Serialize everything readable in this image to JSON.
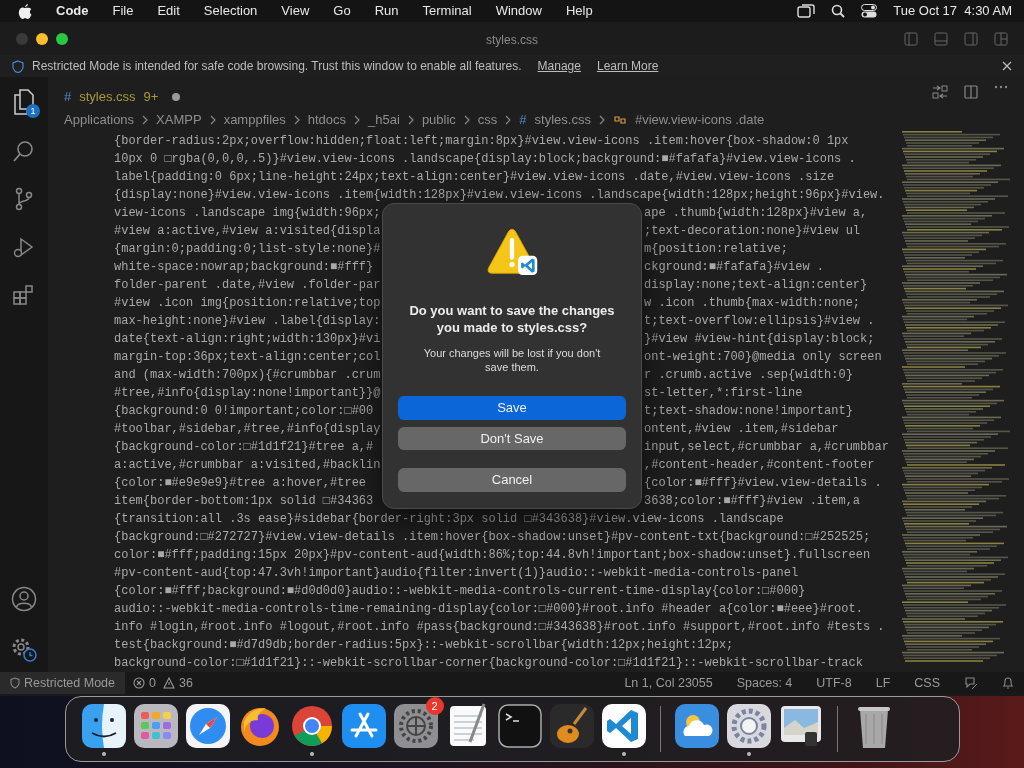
{
  "menubar": {
    "app": "Code",
    "items": [
      "File",
      "Edit",
      "Selection",
      "View",
      "Go",
      "Run",
      "Terminal",
      "Window",
      "Help"
    ],
    "clock": "Tue Oct 17  4:30 AM"
  },
  "window": {
    "title": "styles.css"
  },
  "banner": {
    "text": "Restricted Mode is intended for safe code browsing. Trust this window to enable all features.",
    "links": [
      "Manage",
      "Learn More"
    ]
  },
  "activity_bar": {
    "explorer_badge": "1"
  },
  "tab": {
    "glyph": "#",
    "label": "styles.css",
    "problems": "9+",
    "modified": true
  },
  "breadcrumb": [
    {
      "kind": "folder",
      "label": "Applications"
    },
    {
      "kind": "folder",
      "label": "XAMPP"
    },
    {
      "kind": "folder",
      "label": "xamppfiles"
    },
    {
      "kind": "folder",
      "label": "htdocs"
    },
    {
      "kind": "folder",
      "label": "_h5ai"
    },
    {
      "kind": "folder",
      "label": "public"
    },
    {
      "kind": "folder",
      "label": "css"
    },
    {
      "kind": "file",
      "glyph": "#",
      "label": "styles.css"
    },
    {
      "kind": "symbol",
      "label": "#view.view-icons .date"
    }
  ],
  "code_lines": [
    {
      "segments": [
        "{border-radius:2px;overflow:hidden;float:left;margin:8px}#view.view-icons .item:hover{box-shadow:0 1px"
      ]
    },
    {
      "segments": [
        "10px 0 □rgba(0,0,0,.5)}#view.view-icons .landscape{display:block;background:■#fafafa}#view.view-icons ."
      ]
    },
    {
      "segments": [
        "label{padding:0 6px;line-height:24px;text-align:center}#view.view-icons .date,#view.view-icons .size"
      ]
    },
    {
      "segments": [
        "{display:none}#view.view-icons .item{width:128px}#view.view-icons .landscape{width:128px;height:96px}#view."
      ]
    },
    {
      "segments": [
        "view-icons .landscape img{width:96px;",
        "ape .thumb{width:128px}#view a,"
      ]
    },
    {
      "segments": [
        "#view a:active,#view a:visited{displa",
        ";text-decoration:none}#view ul"
      ]
    },
    {
      "segments": [
        "{margin:0;padding:0;list-style:none}#",
        "m{position:relative;"
      ]
    },
    {
      "segments": [
        "white-space:nowrap;background:■#fff}",
        "ckground:■#fafafa}#view ."
      ]
    },
    {
      "segments": [
        "folder-parent .date,#view .folder-par",
        "display:none;text-align:center}"
      ]
    },
    {
      "segments": [
        "#view .icon img{position:relative;top",
        "w .icon .thumb{max-width:none;"
      ]
    },
    {
      "segments": [
        "max-height:none}#view .label{display:",
        "t;text-overflow:ellipsis}#view ."
      ]
    },
    {
      "segments": [
        "date{text-align:right;width:130px}#vi",
        "}#view #view-hint{display:block;"
      ]
    },
    {
      "segments": [
        "margin-top:36px;text-align:center;col",
        "ont-weight:700}@media only screen"
      ]
    },
    {
      "segments": [
        "and (max-width:700px){#crumbbar .crum",
        "r .crumb.active .sep{width:0}"
      ]
    },
    {
      "segments": [
        "#tree,#info{display:none!important}}@",
        "st-letter,*:first-line"
      ]
    },
    {
      "segments": [
        "{background:0 0!important;color:□#00",
        "t;text-shadow:none!important}"
      ]
    },
    {
      "segments": [
        "#toolbar,#sidebar,#tree,#info{display",
        "ontent,#view .item,#sidebar"
      ]
    },
    {
      "segments": [
        "{background-color:□#1d1f21}#tree a,#",
        "input,select,#crumbbar a,#crumbbar"
      ]
    },
    {
      "segments": [
        "a:active,#crumbbar a:visited,#backlin",
        ",#content-header,#content-footer"
      ]
    },
    {
      "segments": [
        "{color:■#e9e9e9}#tree a:hover,#tree",
        "{color:■#fff}#view.view-details ."
      ]
    },
    {
      "segments": [
        "item{border-bottom:1px solid □#34363",
        "3638;color:■#fff}#view .item,a"
      ]
    },
    {
      "segments": [
        "{transition:all .3s ease}#sidebar{border-right:3px solid □#343638}#view.view-icons .landscape"
      ]
    },
    {
      "segments": [
        "{background:□#272727}#view.view-details .item:hover{box-shadow:unset}#pv-content-txt{background:□#252525;"
      ]
    },
    {
      "segments": [
        "color:■#fff;padding:15px 20px}#pv-content-aud{width:86%;top:44.8vh!important;box-shadow:unset}.fullscreen"
      ]
    },
    {
      "segments": [
        "#pv-content-aud{top:47.3vh!important}audio{filter:invert(1)}audio::-webkit-media-controls-panel"
      ]
    },
    {
      "segments": [
        "{color:■#fff;background:■#d0d0d0}audio::-webkit-media-controls-current-time-display{color:□#000}"
      ]
    },
    {
      "segments": [
        "audio::-webkit-media-controls-time-remaining-display{color:□#000}#root.info #header a{color:■#eee}#root."
      ]
    },
    {
      "segments": [
        "info #login,#root.info #logout,#root.info #pass{background:□#343638}#root.info #support,#root.info #tests ."
      ]
    },
    {
      "segments": [
        "test{background:■#d7d9db;border-radius:5px}::-webkit-scrollbar{width:12px;height:12px;"
      ]
    },
    {
      "segments": [
        "background-color:□#1d1f21}::-webkit-scrollbar-corner{background-color:□#1d1f21}::-webkit-scrollbar-track"
      ]
    }
  ],
  "dialog": {
    "title": "Do you want to save the changes you made to styles.css?",
    "message": "Your changes will be lost if you don't save them.",
    "buttons": [
      {
        "label": "Save",
        "kind": "primary"
      },
      {
        "label": "Don't Save",
        "kind": "secondary"
      },
      {
        "label": "Cancel",
        "kind": "secondary"
      }
    ]
  },
  "status_bar": {
    "mode": "Restricted Mode",
    "errors": "0",
    "warnings": "36",
    "items": [
      "Ln 1, Col 23055",
      "Spaces: 4",
      "UTF-8",
      "LF",
      "CSS"
    ]
  },
  "dock": {
    "items": [
      {
        "kind": "finder",
        "running": true
      },
      {
        "kind": "launchpad",
        "running": false
      },
      {
        "kind": "safari",
        "running": false
      },
      {
        "kind": "firefox",
        "running": false
      },
      {
        "kind": "chrome",
        "running": true
      },
      {
        "kind": "appstore",
        "running": false
      },
      {
        "kind": "settings",
        "running": false,
        "badge": "2"
      },
      {
        "kind": "textedit",
        "running": false
      },
      {
        "kind": "terminal",
        "running": false
      },
      {
        "kind": "garageband",
        "running": false
      },
      {
        "kind": "vscode",
        "running": true
      },
      {
        "kind": "separator"
      },
      {
        "kind": "weather",
        "running": false
      },
      {
        "kind": "prefs",
        "running": true
      },
      {
        "kind": "preview",
        "running": false
      },
      {
        "kind": "separator"
      },
      {
        "kind": "trash",
        "running": false
      }
    ]
  }
}
